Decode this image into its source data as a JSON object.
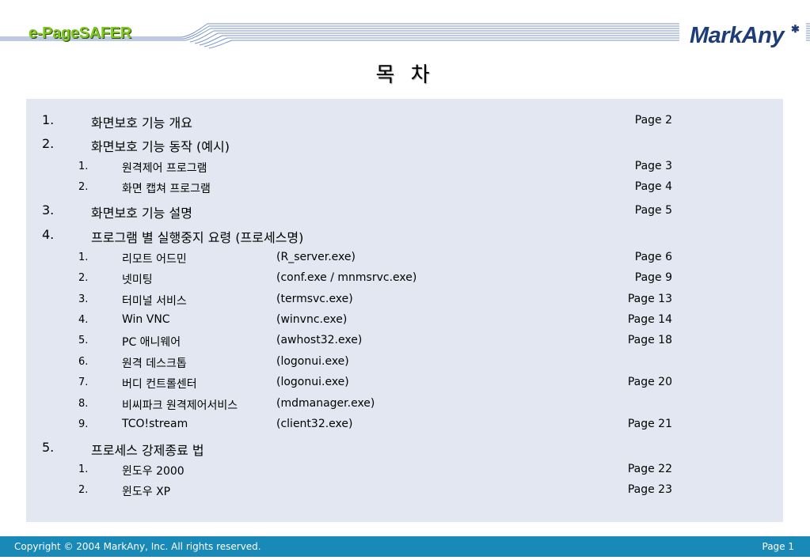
{
  "header": {
    "brand_left": "e-PageSAFER",
    "brand_right": "MarkAny",
    "colors": {
      "brand_left": "#7cc61d",
      "brand_right": "#1e3d78",
      "stripes": "#7d96c6"
    }
  },
  "title": "목 차",
  "toc": [
    {
      "level": 1,
      "num": "1.",
      "label": "화면보호 기능 개요",
      "exe": "",
      "page": "Page 2"
    },
    {
      "level": 1,
      "num": "2.",
      "label": "화면보호 기능 동작 (예시)",
      "exe": "",
      "page": ""
    },
    {
      "level": 2,
      "num": "1.",
      "label": "원격제어 프로그램",
      "exe": "",
      "page": "Page 3"
    },
    {
      "level": 2,
      "num": "2.",
      "label": "화면 캡쳐 프로그램",
      "exe": "",
      "page": "Page 4"
    },
    {
      "level": 1,
      "num": "3.",
      "label": "화면보호 기능 설명",
      "exe": "",
      "page": "Page 5"
    },
    {
      "level": 1,
      "num": "4.",
      "label": "프로그램 별 실행중지 요령 (프로세스명)",
      "exe": "",
      "page": ""
    },
    {
      "level": 2,
      "num": "1.",
      "label": "리모트 어드민",
      "exe": "(R_server.exe)",
      "page": "Page 6"
    },
    {
      "level": 2,
      "num": "2.",
      "label": "넷미팅",
      "exe": "(conf.exe / mnmsrvc.exe)",
      "page": "Page 9"
    },
    {
      "level": 2,
      "num": "3.",
      "label": "터미널 서비스",
      "exe": "(termsvc.exe)",
      "page": "Page 13"
    },
    {
      "level": 2,
      "num": "4.",
      "label": "Win VNC",
      "exe": "(winvnc.exe)",
      "page": "Page 14"
    },
    {
      "level": 2,
      "num": "5.",
      "label": "PC 애니웨어",
      "exe": "(awhost32.exe)",
      "page": "Page 18"
    },
    {
      "level": 2,
      "num": "6.",
      "label": "원격 데스크톱",
      "exe": "(logonui.exe)",
      "page": ""
    },
    {
      "level": 2,
      "num": "7.",
      "label": "버디 컨트롤센터",
      "exe": "(logonui.exe)",
      "page": "Page 20"
    },
    {
      "level": 2,
      "num": "8.",
      "label": "비씨파크 원격제어서비스",
      "exe": "(mdmanager.exe)",
      "page": ""
    },
    {
      "level": 2,
      "num": "9.",
      "label": "TCO!stream",
      "exe": "(client32.exe)",
      "page": "Page 21"
    },
    {
      "level": 1,
      "num": "5.",
      "label": "프로세스 강제종료 법",
      "exe": "",
      "page": ""
    },
    {
      "level": 2,
      "num": "1.",
      "label": "윈도우 2000",
      "exe": "",
      "page": "Page 22"
    },
    {
      "level": 2,
      "num": "2.",
      "label": "윈도우 XP",
      "exe": "",
      "page": "Page 23"
    }
  ],
  "footer": {
    "copyright": "Copyright © 2004 MarkAny, Inc. All rights reserved.",
    "page": "Page 1",
    "color": "#1989b7"
  }
}
